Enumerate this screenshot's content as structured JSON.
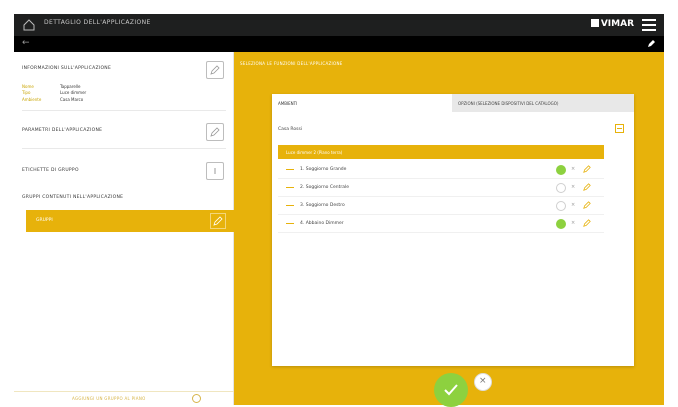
{
  "header": {
    "title": "DETTAGLIO DELL'APPLICAZIONE",
    "brand": "VIMAR"
  },
  "left": {
    "info_title": "INFORMAZIONI SULL'APPLICAZIONE",
    "info_rows": [
      {
        "key": "Nome",
        "value": "Tapparelle"
      },
      {
        "key": "Tipo",
        "value": "Luce dimmer"
      },
      {
        "key": "Ambiente",
        "value": "Casa Marco"
      }
    ],
    "params_title": "PARAMETRI DELL'APPLICAZIONE",
    "group_label_title": "ETICHETTE DI GRUPPO",
    "groups_title": "GRUPPI CONTENUTI NELL'APPLICAZIONE",
    "group_item": "GRUPPI",
    "footer_link": "AGGIUNGI UN GRUPPO AL PIANO"
  },
  "right": {
    "label": "SELEZIONA LE FUNZIONI DELL'APPLICAZIONE",
    "tabs": [
      "AMBIENTI",
      "OPZIONI (SELEZIONE DISPOSITIVI DEL CATALOGO)"
    ],
    "room": "Casa Rossi",
    "function_bar": "Luce dimmer 2 (Piano terra)",
    "rows": [
      {
        "name": "1. Soggiorno Grande",
        "state": "on"
      },
      {
        "name": "2. Soggiorno Centrale",
        "state": "off"
      },
      {
        "name": "3. Soggiorno Destro",
        "state": "off"
      },
      {
        "name": "4. Abbaino Dimmer",
        "state": "on"
      }
    ]
  },
  "colors": {
    "accent": "#e7b20b",
    "header_bg": "#1e1f1f",
    "ok_green": "#8dd13f"
  },
  "icons": {
    "home": "home-icon",
    "menu": "hamburger-menu-icon",
    "back": "back-arrow-icon",
    "edit": "pencil-icon",
    "confirm": "check-icon",
    "cancel": "close-icon"
  }
}
